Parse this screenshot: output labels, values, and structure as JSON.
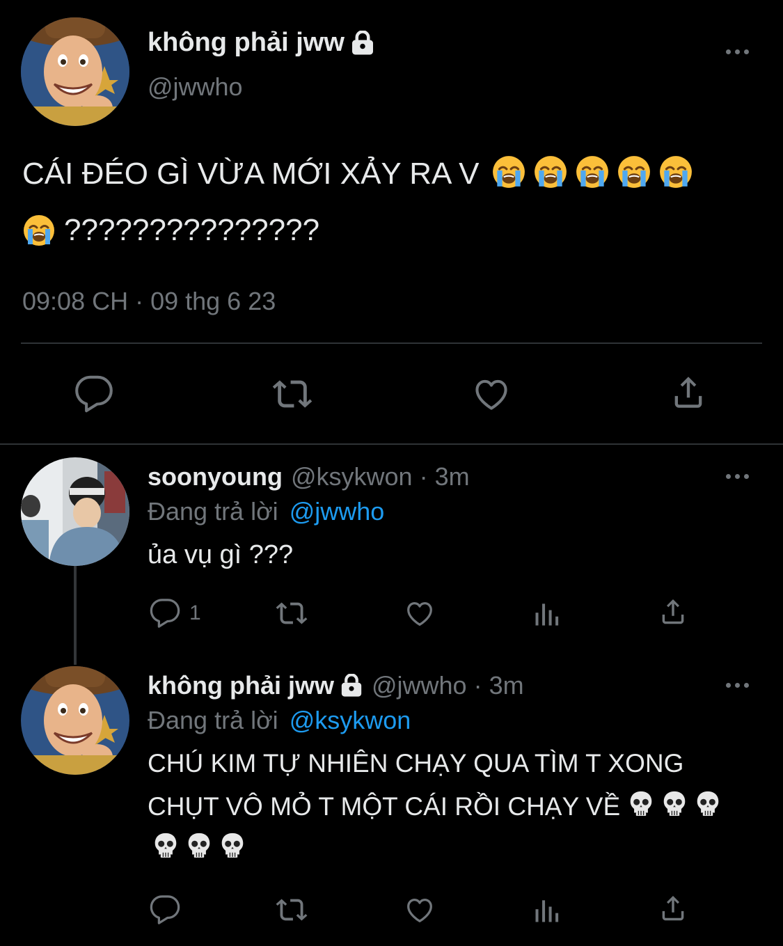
{
  "main_tweet": {
    "display_name": "không phải jww",
    "handle": "@jwwho",
    "text_line1": "CÁI ĐÉO GÌ VỪA MỚI XẢY RA V",
    "text_line2": "???????????????",
    "timestamp": "09:08 CH · 09 thg 6 23",
    "line1_emoji": "loudly-crying-face-emoji",
    "line1_emoji_count": 5,
    "line2_emoji": "loudly-crying-face-emoji",
    "line2_emoji_count": 1,
    "actions": [
      "reply-icon",
      "retweet-icon",
      "like-icon",
      "share-icon"
    ]
  },
  "reply_1": {
    "display_name": "soonyoung",
    "handle": "@ksykwon",
    "time": "· 3m",
    "replying_label": "Đang trả lời",
    "replying_to": "@jwwho",
    "text": "ủa vụ gì ???",
    "reply_count": "1"
  },
  "reply_2": {
    "display_name": "không phải jww",
    "handle": "@jwwho",
    "time": "· 3m",
    "replying_label": "Đang trả lời",
    "replying_to": "@ksykwon",
    "text_line1": "CHÚ KIM TỰ NHIÊN CHẠY QUA TÌM T XONG",
    "text_line2": "CHỤT VÔ MỎ T MỘT CÁI RỒI CHẠY VỀ",
    "line2_emoji": "skull-emoji",
    "line2_emoji_count": 3,
    "line3_emoji": "skull-emoji",
    "line3_emoji_count": 3
  },
  "colors": {
    "background": "#000000",
    "text": "#e7e9ea",
    "muted": "#71767b",
    "link": "#1d9bf0",
    "divider": "#2f3336"
  }
}
